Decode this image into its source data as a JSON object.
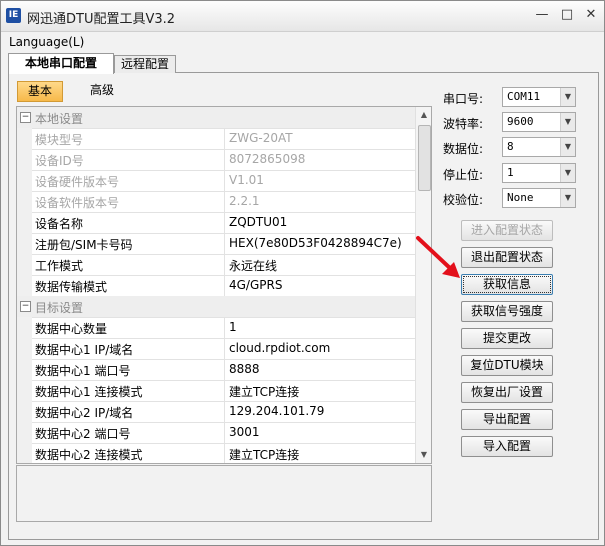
{
  "window": {
    "title": "网迅通DTU配置工具V3.2",
    "icon_text": "IE"
  },
  "menu": {
    "language": "Language(L)"
  },
  "tabs": {
    "local": "本地串口配置",
    "remote": "远程配置"
  },
  "subtabs": {
    "basic": "基本",
    "advanced": "高级"
  },
  "grid": {
    "local_section": "本地设置",
    "local_rows": [
      {
        "key": "模块型号",
        "value": "ZWG-20AT",
        "disabled": true
      },
      {
        "key": "设备ID号",
        "value": "8072865098",
        "disabled": true
      },
      {
        "key": "设备硬件版本号",
        "value": "V1.01",
        "disabled": true
      },
      {
        "key": "设备软件版本号",
        "value": "2.2.1",
        "disabled": true
      },
      {
        "key": "设备名称",
        "value": "ZQDTU01",
        "disabled": false
      },
      {
        "key": "注册包/SIM卡号码",
        "value": "HEX(7e80D53F0428894C7e)",
        "disabled": false
      },
      {
        "key": "工作模式",
        "value": "永远在线",
        "disabled": false
      },
      {
        "key": "数据传输模式",
        "value": "4G/GPRS",
        "disabled": false
      }
    ],
    "target_section": "目标设置",
    "target_rows": [
      {
        "key": "数据中心数量",
        "value": "1"
      },
      {
        "key": "数据中心1 IP/域名",
        "value": "cloud.rpdiot.com"
      },
      {
        "key": "数据中心1 端口号",
        "value": "8888"
      },
      {
        "key": "数据中心1 连接模式",
        "value": "建立TCP连接"
      },
      {
        "key": "数据中心2 IP/域名",
        "value": "129.204.101.79"
      },
      {
        "key": "数据中心2 端口号",
        "value": "3001"
      },
      {
        "key": "数据中心2 连接模式",
        "value": "建立TCP连接"
      }
    ]
  },
  "serial": {
    "port_label": "串口号:",
    "port_value": "COM11",
    "baud_label": "波特率:",
    "baud_value": "9600",
    "data_bits_label": "数据位:",
    "data_bits_value": "8",
    "stop_bits_label": "停止位:",
    "stop_bits_value": "1",
    "parity_label": "校验位:",
    "parity_value": "None"
  },
  "buttons": {
    "enter_config": "进入配置状态",
    "exit_config": "退出配置状态",
    "get_info": "获取信息",
    "get_signal": "获取信号强度",
    "submit": "提交更改",
    "reset_dtu": "复位DTU模块",
    "factory_reset": "恢复出厂设置",
    "export": "导出配置",
    "import": "导入配置"
  },
  "colors": {
    "subtab_active": "#f7b94a",
    "annotation_arrow": "#e3101b"
  }
}
